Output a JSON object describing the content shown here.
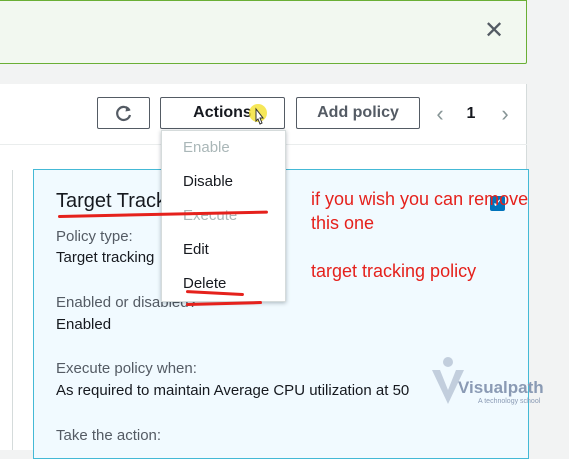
{
  "banner": {
    "close_glyph": "✕"
  },
  "toolbar": {
    "refresh_glyph": "↻",
    "actions_label": "Actions",
    "add_policy_label": "Add policy",
    "pager": {
      "prev": "‹",
      "page": "1",
      "next": "›"
    }
  },
  "actions_menu": {
    "items": [
      {
        "label": "Enable",
        "disabled": true
      },
      {
        "label": "Disable",
        "disabled": false
      },
      {
        "label": "Execute",
        "disabled": true
      },
      {
        "label": "Edit",
        "disabled": false
      },
      {
        "label": "Delete",
        "disabled": false
      }
    ]
  },
  "policy_card": {
    "title": "Target Track",
    "policy_type_label": "Policy type:",
    "policy_type_value": "Target tracking",
    "enabled_label": "Enabled or disabled?",
    "enabled_value": "Enabled",
    "execute_label": "Execute policy when:",
    "execute_value": "As required to maintain Average CPU utilization at 50",
    "action_label": "Take the action:"
  },
  "annotations": {
    "line1": "if you wish you can remove",
    "line2": "this one",
    "line3": "target tracking policy",
    "color": "#e5211c"
  },
  "watermark": {
    "brand": "Visualpath",
    "tagline": "A technology school"
  },
  "colors": {
    "accent": "#0073bb",
    "card_border": "#44b9d6",
    "banner_border": "#6aaf35"
  }
}
